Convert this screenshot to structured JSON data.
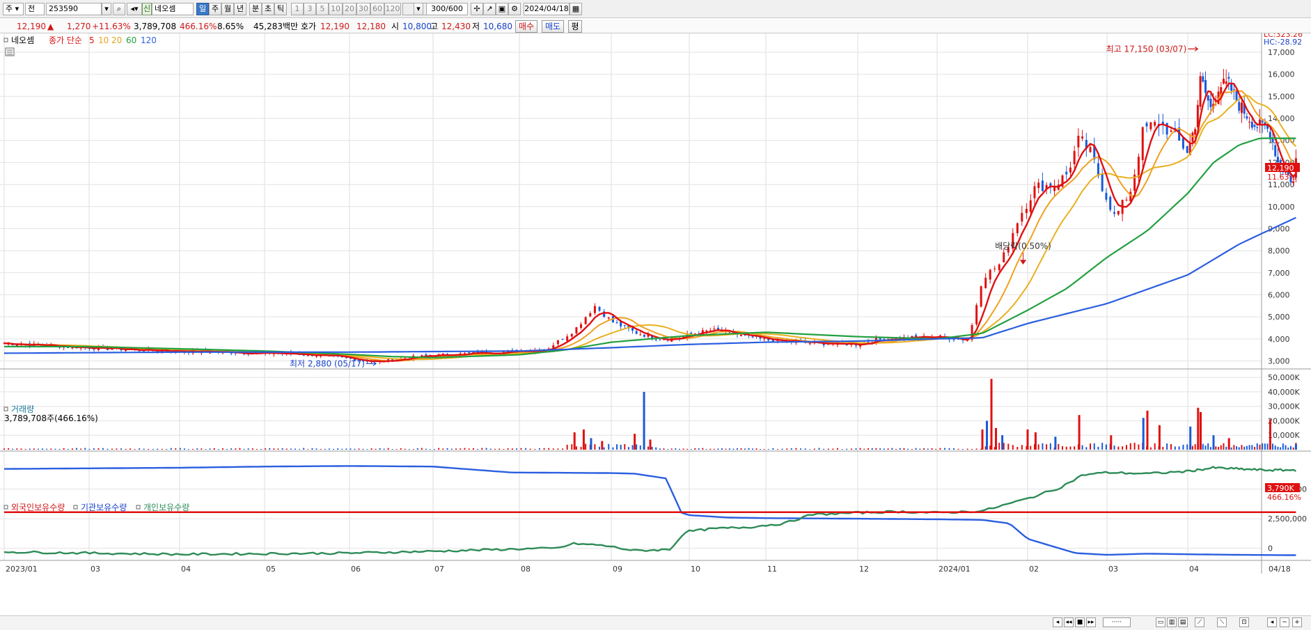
{
  "toolbar": {
    "market": "주",
    "type": "전",
    "code": "253590",
    "badge": "신",
    "name": "네오셈",
    "periods": [
      "일",
      "주",
      "월",
      "년",
      "분",
      "초",
      "틱"
    ],
    "active_period": "일",
    "minutes": [
      "1",
      "3",
      "5",
      "10",
      "20",
      "30",
      "60",
      "120"
    ],
    "count": "300/600",
    "date": "2024/04/18"
  },
  "quote": {
    "price": "12,190",
    "arrow": "▲",
    "change": "1,270",
    "change_pct": "+11.63%",
    "volume": "3,789,708",
    "vol_ratio": "466.16%",
    "turnover": "8.65%",
    "amount": "45,283백만",
    "hoga_label": "호가",
    "ask": "12,190",
    "bid": "12,180",
    "open_label": "시",
    "open": "10,800",
    "high_label": "고",
    "high": "12,430",
    "low_label": "저",
    "low": "10,680",
    "buy": "매수",
    "sell": "매도",
    "eval": "평"
  },
  "panels": {
    "price": {
      "name": "네오셈",
      "ma_label": "종가 단순",
      "ma_periods": [
        "5",
        "10",
        "20",
        "60",
        "120"
      ],
      "lc": "LC:323.26",
      "hc": "HC:-28.92",
      "max_label": "최고 17,150 (03/07)",
      "min_label": "최저 2,880 (05/17)",
      "dividend_label": "배당락(0.50%)",
      "last_price": "12,190",
      "last_pct": "11.63%"
    },
    "volume": {
      "title": "거래량",
      "info": "3,789,708주(466.16%)",
      "last": "3,790K",
      "last_pct": "466.16%"
    },
    "holdings": {
      "foreign": "외국인보유수량",
      "inst": "기관보유수량",
      "indiv": "개인보유수량"
    }
  },
  "colors": {
    "up": "#e01010",
    "down": "#1a5ad8",
    "ma5": "#e01010",
    "ma10": "#f0a020",
    "ma20": "#e8b020",
    "ma60": "#22a040",
    "ma120": "#2a5ee0",
    "foreign": "#2a5ee0",
    "inst": "#2e8b57",
    "indiv": "#e01010"
  },
  "chart_data": [
    {
      "type": "candlestick",
      "title": "네오셈",
      "y_ticks": [
        3000,
        4000,
        5000,
        6000,
        7000,
        8000,
        9000,
        10000,
        11000,
        12000,
        13000,
        14000,
        15000,
        16000,
        17000
      ],
      "ylim": [
        2700,
        17600
      ],
      "x_tick_labels": [
        "2023/01",
        "03",
        "04",
        "05",
        "06",
        "07",
        "08",
        "09",
        "10",
        "11",
        "12",
        "2024/01",
        "02",
        "03",
        "04",
        "04/18"
      ],
      "key_points": [
        {
          "label": "max",
          "value": 17150,
          "date": "03/07"
        },
        {
          "label": "min",
          "value": 2880,
          "date": "05/17"
        },
        {
          "label": "last",
          "value": 12190
        }
      ],
      "close_path": [
        {
          "m": 0,
          "v": 3800
        },
        {
          "m": 0.5,
          "v": 3700
        },
        {
          "m": 1,
          "v": 3600
        },
        {
          "m": 1.5,
          "v": 3500
        },
        {
          "m": 2,
          "v": 3450
        },
        {
          "m": 2.5,
          "v": 3400
        },
        {
          "m": 3,
          "v": 3350
        },
        {
          "m": 3.5,
          "v": 3300
        },
        {
          "m": 4.35,
          "v": 2950
        },
        {
          "m": 4.7,
          "v": 3150
        },
        {
          "m": 5,
          "v": 3250
        },
        {
          "m": 5.5,
          "v": 3350
        },
        {
          "m": 6,
          "v": 3450
        },
        {
          "m": 6.3,
          "v": 3550
        },
        {
          "m": 6.6,
          "v": 4400
        },
        {
          "m": 6.82,
          "v": 5500
        },
        {
          "m": 7,
          "v": 4800
        },
        {
          "m": 7.3,
          "v": 4300
        },
        {
          "m": 7.6,
          "v": 4000
        },
        {
          "m": 7.9,
          "v": 4050
        },
        {
          "m": 8,
          "v": 4200
        },
        {
          "m": 8.3,
          "v": 4400
        },
        {
          "m": 8.6,
          "v": 4200
        },
        {
          "m": 9,
          "v": 3950
        },
        {
          "m": 9.5,
          "v": 3800
        },
        {
          "m": 10,
          "v": 3750
        },
        {
          "m": 10.2,
          "v": 3950
        },
        {
          "m": 10.6,
          "v": 4050
        },
        {
          "m": 11,
          "v": 4100
        },
        {
          "m": 11.35,
          "v": 3950
        },
        {
          "m": 11.5,
          "v": 6800
        },
        {
          "m": 11.7,
          "v": 7400
        },
        {
          "m": 11.9,
          "v": 9500
        },
        {
          "m": 12.1,
          "v": 10900
        },
        {
          "m": 12.35,
          "v": 11000
        },
        {
          "m": 12.5,
          "v": 11500
        },
        {
          "m": 12.65,
          "v": 13100
        },
        {
          "m": 12.8,
          "v": 12400
        },
        {
          "m": 12.95,
          "v": 10800
        },
        {
          "m": 13.1,
          "v": 9500
        },
        {
          "m": 13.3,
          "v": 10800
        },
        {
          "m": 13.45,
          "v": 13500
        },
        {
          "m": 13.65,
          "v": 13800
        },
        {
          "m": 13.8,
          "v": 13300
        },
        {
          "m": 14,
          "v": 12500
        },
        {
          "m": 14.15,
          "v": 13800
        },
        {
          "m": 14.25,
          "v": 15800
        },
        {
          "m": 14.45,
          "v": 14400
        },
        {
          "m": 14.6,
          "v": 15500
        },
        {
          "m": 14.8,
          "v": 15500
        },
        {
          "m": 15,
          "v": 14600
        },
        {
          "m": 15.3,
          "v": 13700
        },
        {
          "m": 15.5,
          "v": 13600
        },
        {
          "m": 15.6,
          "v": 13400
        },
        {
          "m": 15.75,
          "v": 12000
        },
        {
          "m": 15.95,
          "v": 11400
        },
        {
          "m": 16.05,
          "v": 11100
        },
        {
          "m": 16.1,
          "v": 12190
        }
      ],
      "ma_paths": {
        "ma60": [
          {
            "m": 0,
            "v": 3650
          },
          {
            "m": 1,
            "v": 3650
          },
          {
            "m": 2,
            "v": 3550
          },
          {
            "m": 3,
            "v": 3450
          },
          {
            "m": 4,
            "v": 3300
          },
          {
            "m": 4.5,
            "v": 3200
          },
          {
            "m": 5,
            "v": 3150
          },
          {
            "m": 6,
            "v": 3280
          },
          {
            "m": 6.5,
            "v": 3500
          },
          {
            "m": 7,
            "v": 3850
          },
          {
            "m": 8,
            "v": 4150
          },
          {
            "m": 9,
            "v": 4300
          },
          {
            "m": 10,
            "v": 4100
          },
          {
            "m": 11,
            "v": 4000
          },
          {
            "m": 11.5,
            "v": 4250
          },
          {
            "m": 12,
            "v": 5300
          },
          {
            "m": 12.5,
            "v": 6300
          },
          {
            "m": 13,
            "v": 7700
          },
          {
            "m": 13.5,
            "v": 8900
          },
          {
            "m": 14,
            "v": 10600
          },
          {
            "m": 14.5,
            "v": 12000
          },
          {
            "m": 15,
            "v": 12800
          },
          {
            "m": 15.4,
            "v": 13100
          },
          {
            "m": 16.1,
            "v": 13100
          }
        ],
        "ma120": [
          {
            "m": 0,
            "v": 3350
          },
          {
            "m": 2,
            "v": 3400
          },
          {
            "m": 4,
            "v": 3400
          },
          {
            "m": 6,
            "v": 3450
          },
          {
            "m": 7,
            "v": 3600
          },
          {
            "m": 8,
            "v": 3750
          },
          {
            "m": 9,
            "v": 3850
          },
          {
            "m": 10,
            "v": 3900
          },
          {
            "m": 11,
            "v": 4000
          },
          {
            "m": 11.5,
            "v": 4050
          },
          {
            "m": 12,
            "v": 4700
          },
          {
            "m": 13,
            "v": 5600
          },
          {
            "m": 14,
            "v": 6900
          },
          {
            "m": 15,
            "v": 8300
          },
          {
            "m": 16.1,
            "v": 9500
          }
        ]
      }
    },
    {
      "type": "bar",
      "title": "거래량",
      "y_ticks": [
        "10,000K",
        "20,000K",
        "30,000K",
        "40,000K",
        "50,000K"
      ],
      "ylim": [
        0,
        52000
      ],
      "spikes": [
        {
          "m": 6.6,
          "v": 12000
        },
        {
          "m": 6.7,
          "v": 14000
        },
        {
          "m": 6.78,
          "v": 8000
        },
        {
          "m": 6.9,
          "v": 6000
        },
        {
          "m": 7.3,
          "v": 11000
        },
        {
          "m": 7.42,
          "v": 40000
        },
        {
          "m": 7.5,
          "v": 7000
        },
        {
          "m": 11.5,
          "v": 14000
        },
        {
          "m": 11.55,
          "v": 20000
        },
        {
          "m": 11.6,
          "v": 49000
        },
        {
          "m": 11.65,
          "v": 15000
        },
        {
          "m": 11.72,
          "v": 10000
        },
        {
          "m": 12.0,
          "v": 14000
        },
        {
          "m": 12.1,
          "v": 12000
        },
        {
          "m": 12.35,
          "v": 9000
        },
        {
          "m": 12.65,
          "v": 24000
        },
        {
          "m": 13.05,
          "v": 10000
        },
        {
          "m": 13.45,
          "v": 22000
        },
        {
          "m": 13.5,
          "v": 27000
        },
        {
          "m": 13.65,
          "v": 17000
        },
        {
          "m": 14.05,
          "v": 16000
        },
        {
          "m": 14.2,
          "v": 29000
        },
        {
          "m": 14.25,
          "v": 26000
        },
        {
          "m": 14.5,
          "v": 10000
        },
        {
          "m": 14.8,
          "v": 8000
        },
        {
          "m": 15.6,
          "v": 21000
        },
        {
          "m": 16.1,
          "v": 3790
        }
      ]
    },
    {
      "type": "line",
      "title": "보유수량",
      "y_ticks": [
        "0",
        "2,500,000",
        "5,000,000"
      ],
      "ylim": [
        -900000,
        7500000
      ],
      "series": [
        {
          "name": "외국인보유수량",
          "points": [
            {
              "m": 0,
              "v": 6700000
            },
            {
              "m": 2,
              "v": 6800000
            },
            {
              "m": 3,
              "v": 6900000
            },
            {
              "m": 4,
              "v": 6950000
            },
            {
              "m": 5,
              "v": 6900000
            },
            {
              "m": 5.9,
              "v": 6400000
            },
            {
              "m": 7,
              "v": 6350000
            },
            {
              "m": 7.3,
              "v": 6300000
            },
            {
              "m": 7.7,
              "v": 5900000
            },
            {
              "m": 7.9,
              "v": 3000000
            },
            {
              "m": 8,
              "v": 2800000
            },
            {
              "m": 8.5,
              "v": 2600000
            },
            {
              "m": 9,
              "v": 2550000
            },
            {
              "m": 10,
              "v": 2500000
            },
            {
              "m": 11,
              "v": 2450000
            },
            {
              "m": 11.5,
              "v": 2400000
            },
            {
              "m": 11.8,
              "v": 2100000
            },
            {
              "m": 12,
              "v": 800000
            },
            {
              "m": 12.3,
              "v": 200000
            },
            {
              "m": 12.6,
              "v": -400000
            },
            {
              "m": 13,
              "v": -550000
            },
            {
              "m": 13.5,
              "v": -450000
            },
            {
              "m": 14,
              "v": -500000
            },
            {
              "m": 15,
              "v": -550000
            },
            {
              "m": 16.1,
              "v": -580000
            }
          ]
        },
        {
          "name": "기관보유수량",
          "points": [
            {
              "m": 0,
              "v": -300000
            },
            {
              "m": 1,
              "v": -400000
            },
            {
              "m": 2,
              "v": -500000
            },
            {
              "m": 3,
              "v": -450000
            },
            {
              "m": 4,
              "v": -400000
            },
            {
              "m": 5,
              "v": -250000
            },
            {
              "m": 6,
              "v": -50000
            },
            {
              "m": 6.4,
              "v": 0
            },
            {
              "m": 6.6,
              "v": 400000
            },
            {
              "m": 6.9,
              "v": 250000
            },
            {
              "m": 7.3,
              "v": -200000
            },
            {
              "m": 7.75,
              "v": -100000
            },
            {
              "m": 7.95,
              "v": 1400000
            },
            {
              "m": 8.3,
              "v": 1650000
            },
            {
              "m": 8.8,
              "v": 1800000
            },
            {
              "m": 9.2,
              "v": 2100000
            },
            {
              "m": 9.5,
              "v": 2850000
            },
            {
              "m": 10,
              "v": 3000000
            },
            {
              "m": 10.5,
              "v": 3100000
            },
            {
              "m": 11,
              "v": 3000000
            },
            {
              "m": 11.5,
              "v": 3150000
            },
            {
              "m": 12,
              "v": 4200000
            },
            {
              "m": 12.4,
              "v": 5100000
            },
            {
              "m": 12.7,
              "v": 6200000
            },
            {
              "m": 13,
              "v": 6400000
            },
            {
              "m": 13.5,
              "v": 6300000
            },
            {
              "m": 14,
              "v": 6500000
            },
            {
              "m": 14.5,
              "v": 6800000
            },
            {
              "m": 15,
              "v": 6700000
            },
            {
              "m": 15.5,
              "v": 6600000
            },
            {
              "m": 16.1,
              "v": 6600000
            }
          ]
        },
        {
          "name": "개인보유수량",
          "points": [
            {
              "m": 0,
              "v": 3050000
            },
            {
              "m": 16.1,
              "v": 3050000
            }
          ]
        }
      ]
    }
  ]
}
